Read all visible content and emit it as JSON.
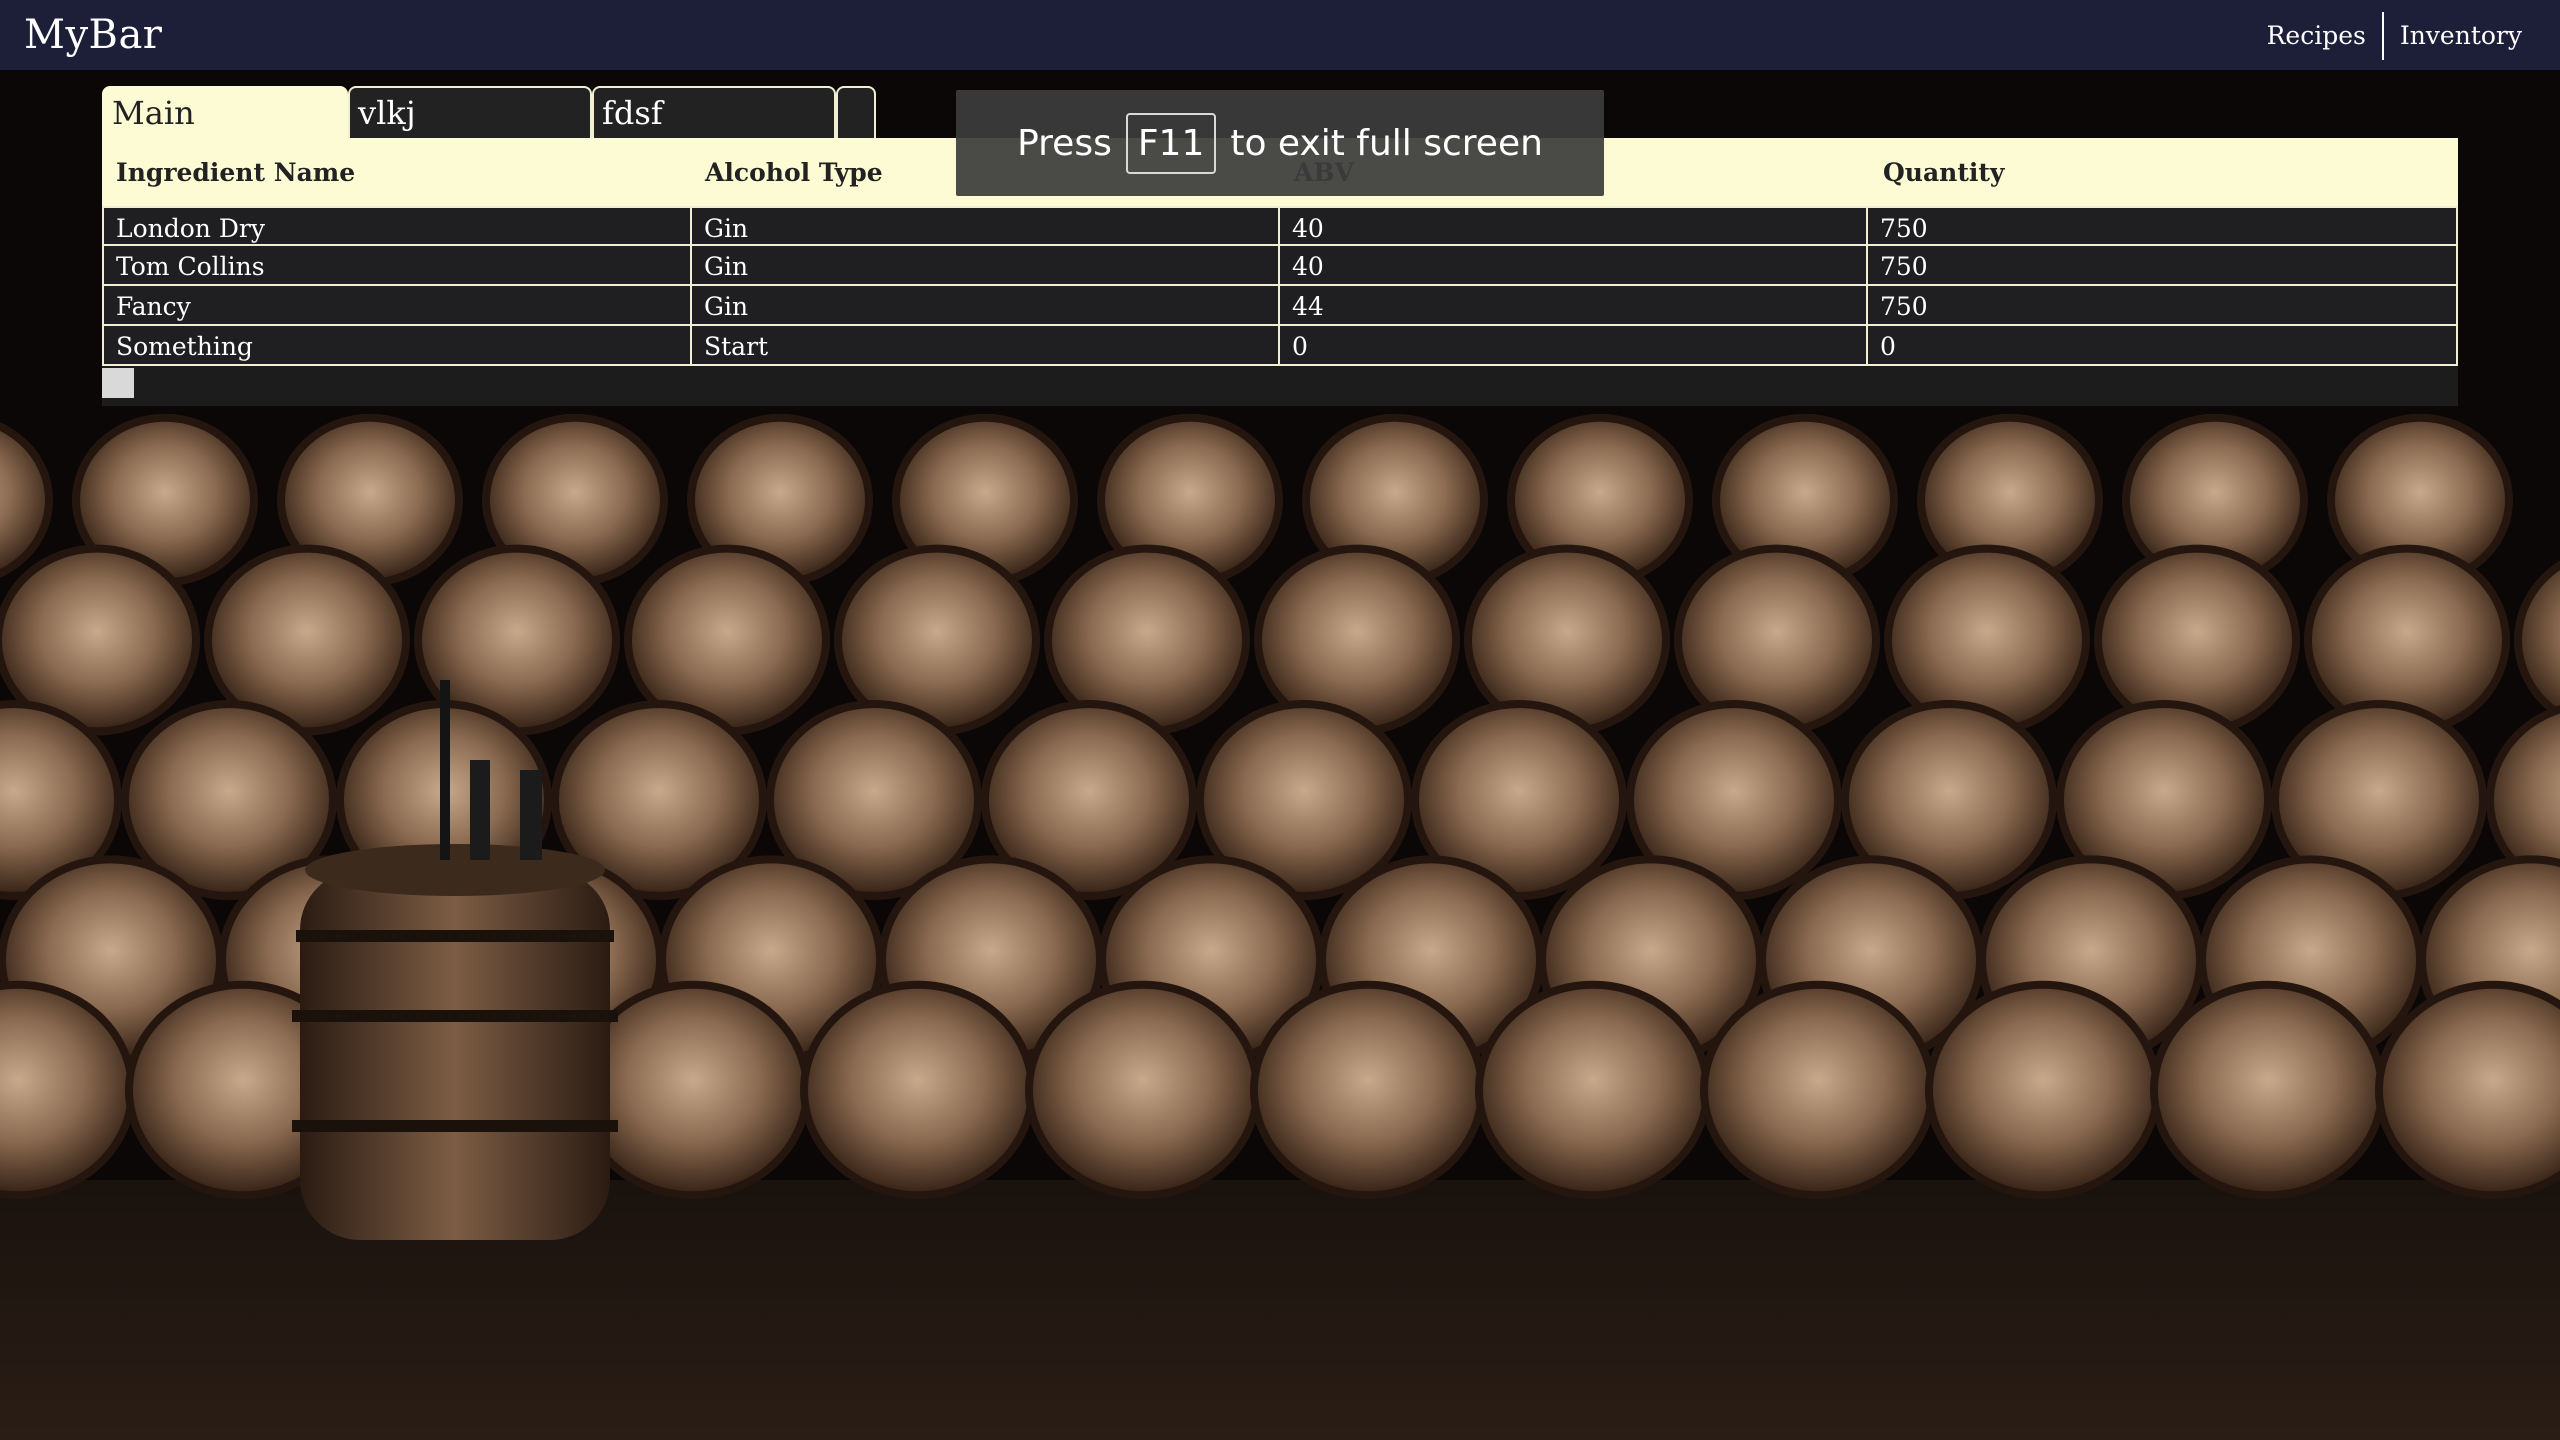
{
  "app": {
    "title": "MyBar"
  },
  "nav": {
    "recipes": "Recipes",
    "inventory": "Inventory"
  },
  "tabs": [
    {
      "label": "Main",
      "active": true
    },
    {
      "label": "vlkj",
      "active": false
    },
    {
      "label": "fdsf",
      "active": false
    },
    {
      "label": "",
      "active": false
    }
  ],
  "table": {
    "columns": [
      "Ingredient Name",
      "Alcohol Type",
      "ABV",
      "Quantity"
    ],
    "rows": [
      [
        "London Dry",
        "Gin",
        "40",
        "750"
      ],
      [
        "Tom Collins",
        "Gin",
        "40",
        "750"
      ],
      [
        "Fancy",
        "Gin",
        "44",
        "750"
      ],
      [
        "Something",
        "Start",
        "0",
        "0"
      ]
    ]
  },
  "toast": {
    "press": "Press",
    "key": "F11",
    "rest": "to exit full screen"
  },
  "colors": {
    "topbar": "#1d1f38",
    "header_bg": "#fdfbd4",
    "row_bg": "#1f1f22",
    "border": "#f1efd3"
  }
}
